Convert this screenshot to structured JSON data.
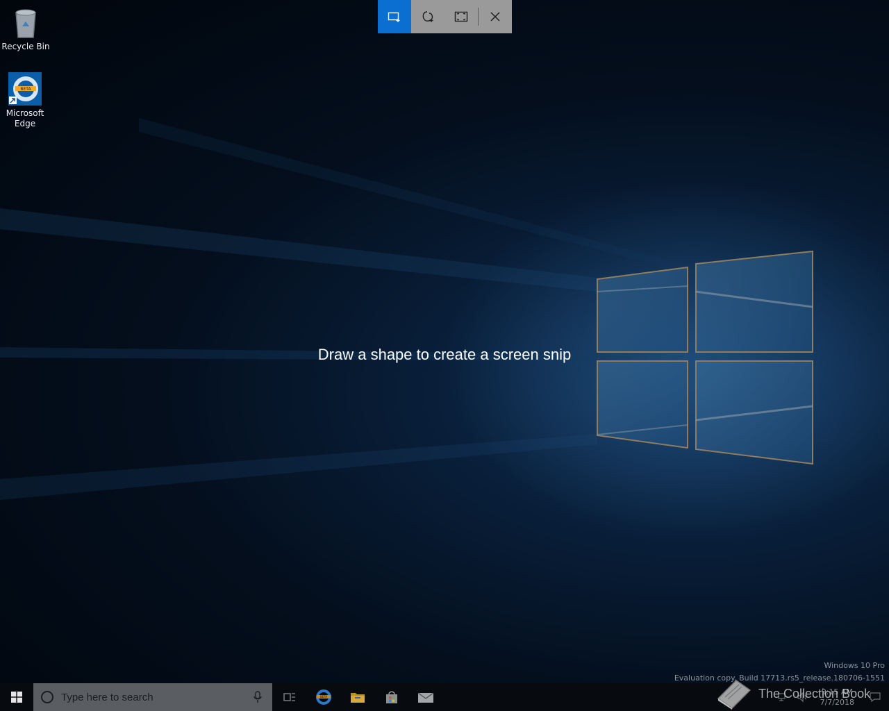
{
  "desktop": {
    "icons": [
      {
        "label": "Recycle Bin",
        "icon": "recycle-bin-icon"
      },
      {
        "label": "Microsoft\nEdge",
        "label_line1": "Microsoft",
        "label_line2": "Edge",
        "icon": "edge-beta-icon"
      }
    ]
  },
  "snip_toolbar": {
    "buttons": [
      {
        "name": "rectangular-snip",
        "icon": "rectangle-snip-icon",
        "active": true
      },
      {
        "name": "freeform-snip",
        "icon": "freeform-snip-icon",
        "active": false
      },
      {
        "name": "fullscreen-snip",
        "icon": "fullscreen-snip-icon",
        "active": false
      },
      {
        "name": "close-snip",
        "icon": "close-icon",
        "active": false
      }
    ],
    "accent_color": "#0a6fd1"
  },
  "snip_hint": "Draw a shape to create a screen snip",
  "watermark": {
    "line1": "Windows 10 Pro",
    "line2": "Evaluation copy. Build 17713.rs5_release.180706-1551"
  },
  "taskbar": {
    "search_placeholder": "Type here to search",
    "pinned": [
      "task-view-icon",
      "edge-beta-icon",
      "file-explorer-icon",
      "store-icon",
      "mail-icon"
    ],
    "clock_time": "9:15 AM",
    "clock_date": "7/7/2018"
  },
  "overlay_text": "The Collection Book"
}
